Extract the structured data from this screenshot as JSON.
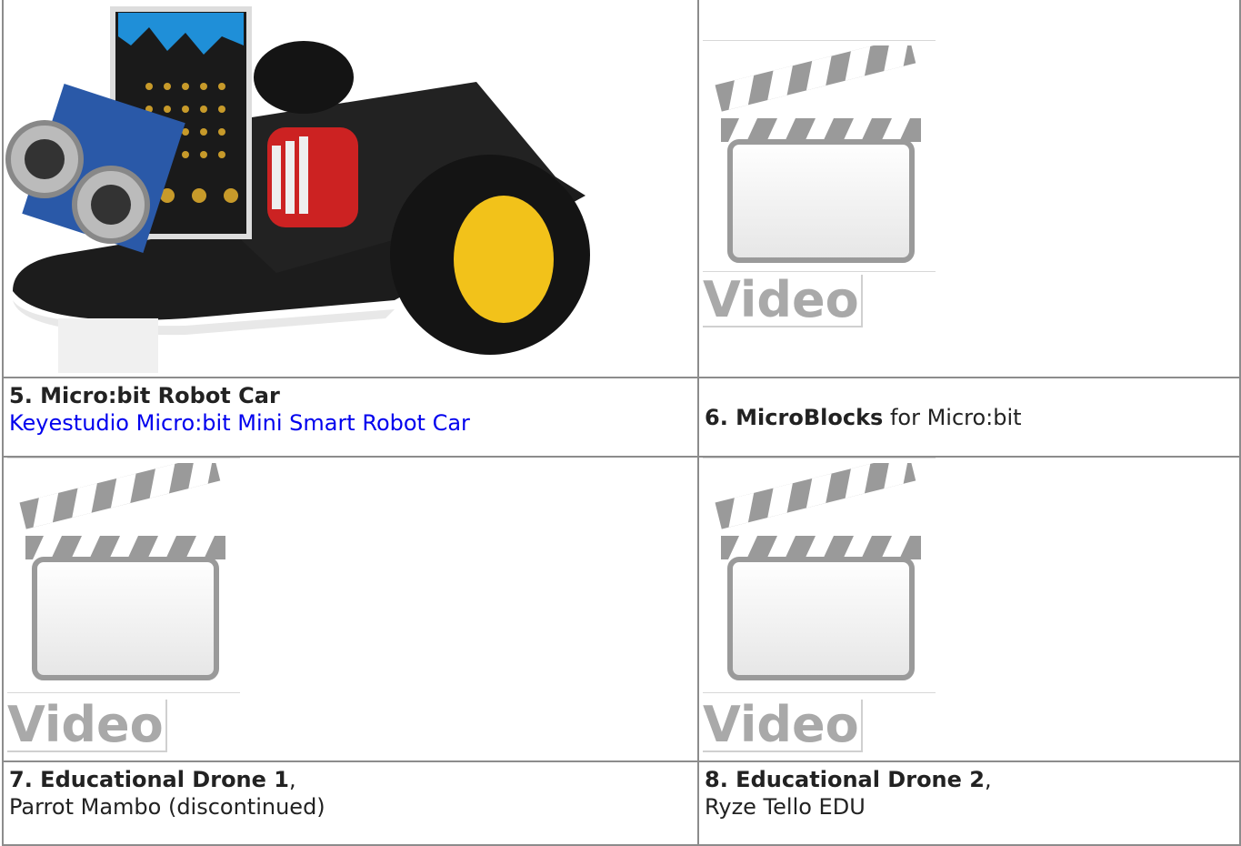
{
  "cells": {
    "c5": {
      "title": "5. Micro:bit Robot Car",
      "link": "Keyestudio Micro:bit Mini Smart Robot Car",
      "image_alt": "micro:bit robot car photo"
    },
    "c6": {
      "title": "6. MicroBlocks",
      "suffix": " for Micro:bit",
      "video_label": "Video"
    },
    "c7": {
      "title": "7. Educational Drone 1",
      "sep": ",",
      "subtitle": "Parrot Mambo (discontinued)",
      "video_label": "Video"
    },
    "c8": {
      "title": "8. Educational Drone 2",
      "sep": ",",
      "subtitle": "Ryze Tello EDU",
      "video_label": "Video"
    }
  },
  "colors": {
    "link": "#0000ee",
    "border": "#8c8c8c",
    "video_text": "#a9a9a9"
  },
  "icons": [
    "clapperboard-icon",
    "robot-car-image"
  ]
}
